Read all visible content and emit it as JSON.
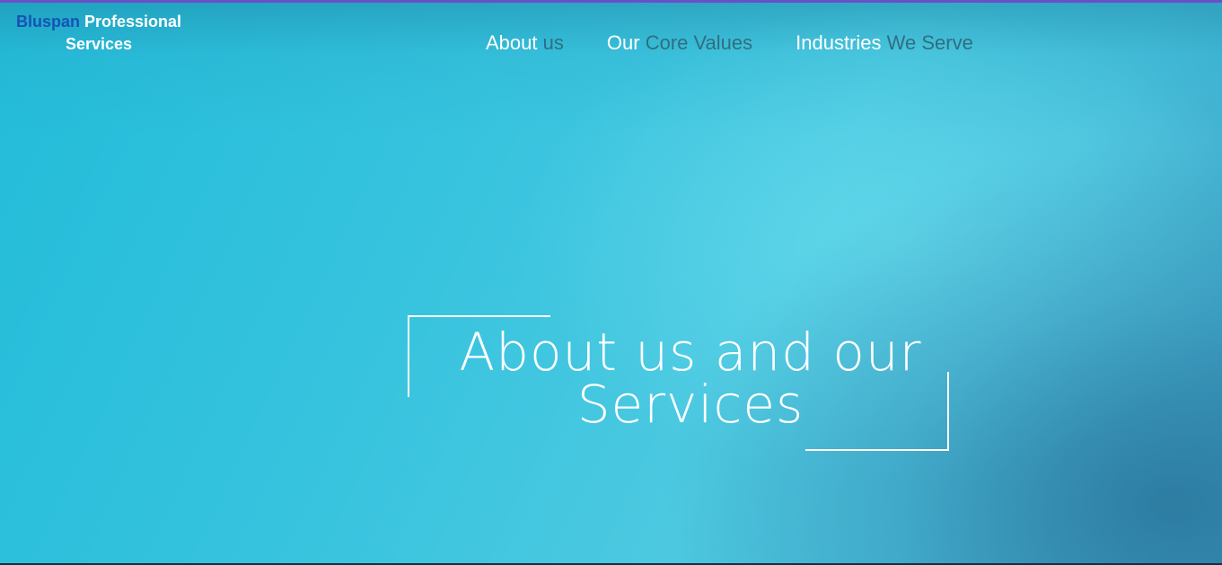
{
  "logo": {
    "brand": "Bluspan",
    "rest": "Professional Services"
  },
  "nav": {
    "items": [
      {
        "word1": "About",
        "word2": "us"
      },
      {
        "word1": "Our",
        "word2": "Core Values"
      },
      {
        "word1": "Industries",
        "word2": "We Serve"
      }
    ]
  },
  "hero": {
    "line1": "About us and our",
    "line2": "Services"
  },
  "colors": {
    "brand": "#1553b8",
    "nav_accent": "#2f6f80",
    "background_primary": "#36c3de",
    "top_bar": "#6a4fc8"
  }
}
